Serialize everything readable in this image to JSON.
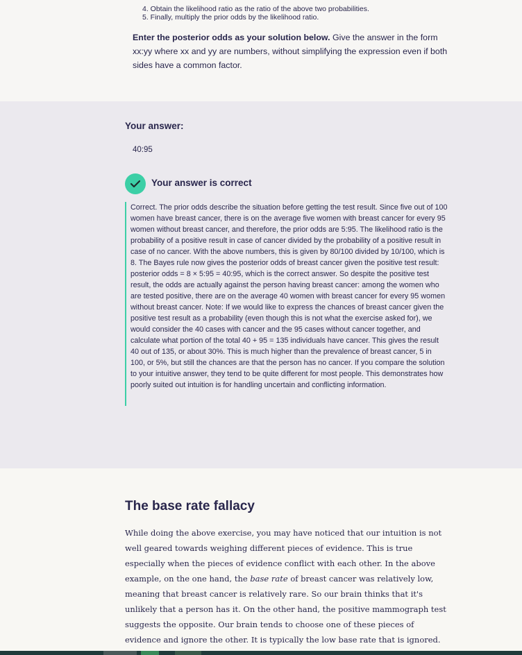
{
  "steps": {
    "step4": "4. Obtain the likelihood ratio as the ratio of the above two probabilities.",
    "step5": "5. Finally, multiply the prior odds by the likelihood ratio."
  },
  "prompt": {
    "bold": "Enter the posterior odds as your solution below.",
    "rest": " Give the answer in the form xx:yy where xx and yy are numbers, without simplifying the expression even if both sides have a common factor."
  },
  "answer": {
    "label": "Your answer:",
    "value": "40:95",
    "status": "Your answer is correct",
    "explanation": "Correct. The prior odds describe the situation before getting the test result. Since five out of 100 women have breast cancer, there is on the average five women with breast cancer for every 95 women without breast cancer, and therefore, the prior odds are 5:95. The likelihood ratio is the probability of a positive result in case of cancer divided by the probability of a positive result in case of no cancer. With the above numbers, this is given by 80/100 divided by 10/100, which is 8. The Bayes rule now gives the posterior odds of breast cancer given the positive test result: posterior odds = 8 × 5:95 = 40:95, which is the correct answer. So despite the positive test result, the odds are actually against the person having breast cancer: among the women who are tested positive, there are on the average 40 women with breast cancer for every 95 women without breast cancer. Note: If we would like to express the chances of breast cancer given the positive test result as a probability (even though this is not what the exercise asked for), we would consider the 40 cases with cancer and the 95 cases without cancer together, and calculate what portion of the total 40 + 95 = 135 individuals have cancer. This gives the result 40 out of 135, or about 30%. This is much higher than the prevalence of breast cancer, 5 in 100, or 5%, but still the chances are that the person has no cancer. If you compare the solution to your intuitive answer, they tend to be quite different for most people. This demonstrates how poorly suited out intuition is for handling uncertain and conflicting information."
  },
  "section": {
    "title": "The base rate fallacy",
    "para_part1": "While doing the above exercise, you may have noticed that our intuition is not well geared towards weighing different pieces of evidence. This is true especially when the pieces of evidence conflict with each other. In the above example, on the one hand, the ",
    "para_italic": "base rate",
    "para_part2": " of breast cancer was relatively low, meaning that breast cancer is relatively rare. So our brain thinks that it's unlikely that a person has it. On the other hand, the positive mammograph test suggests the opposite. Our brain tends to choose one of these pieces of evidence and ignore the other. It is typically the low base rate that is ignored. That's why your intuition probably says that the"
  },
  "colors": {
    "accent": "#3ccfa6",
    "text": "#29264c",
    "answer_bg": "#ebe9ee",
    "page_bg": "#f7f6f4"
  },
  "icons": {
    "check": "checkmark-icon"
  }
}
